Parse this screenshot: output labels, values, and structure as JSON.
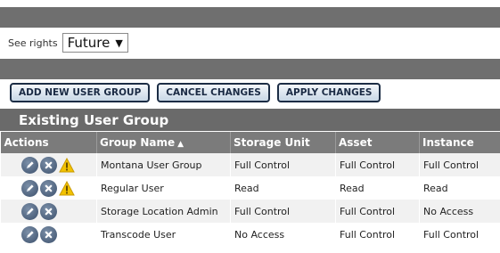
{
  "rights": {
    "label": "See rights",
    "selected": "Future"
  },
  "buttons": {
    "add": "ADD NEW USER GROUP",
    "cancel": "CANCEL CHANGES",
    "apply": "APPLY CHANGES"
  },
  "panel_title": "Existing User Group",
  "table": {
    "headers": {
      "actions": "Actions",
      "group": "Group Name",
      "storage": "Storage Unit",
      "asset": "Asset",
      "instance": "Instance"
    },
    "sort": "ascending",
    "rows": [
      {
        "group": "Montana User Group",
        "storage": "Full Control",
        "asset": "Full Control",
        "instance": "Full Control",
        "warning": true
      },
      {
        "group": "Regular User",
        "storage": "Read",
        "asset": "Read",
        "instance": "Read",
        "warning": true
      },
      {
        "group": "Storage Location Admin",
        "storage": "Full Control",
        "asset": "Full Control",
        "instance": "No Access",
        "warning": false
      },
      {
        "group": "Transcode User",
        "storage": "No Access",
        "asset": "Full Control",
        "instance": "Full Control",
        "warning": false
      }
    ]
  },
  "colors": {
    "header_bar": "#6f6f6f",
    "table_header": "#7b7b7b",
    "button_border": "#1c2d45",
    "warning": "#f2c200"
  },
  "icons": {
    "edit": "pencil-icon",
    "delete": "x-circle-icon",
    "warning": "warning-icon"
  }
}
